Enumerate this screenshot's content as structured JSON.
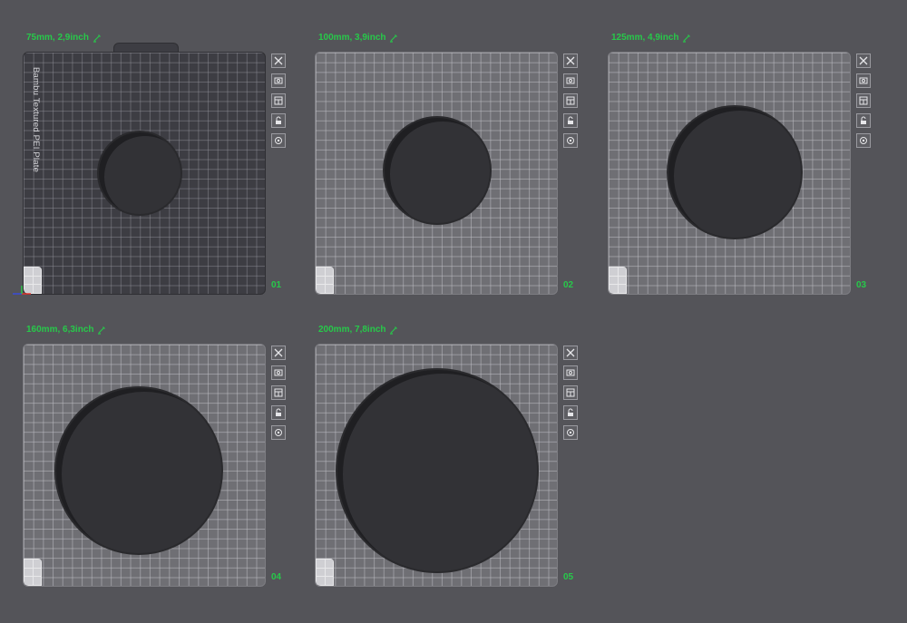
{
  "plates": [
    {
      "id": "plate-01",
      "title": "75mm, 2,9inch",
      "number": "01",
      "textured": true,
      "plate_name": "Bambu Textured PEI Plate"
    },
    {
      "id": "plate-02",
      "title": "100mm, 3,9inch",
      "number": "02",
      "textured": false
    },
    {
      "id": "plate-03",
      "title": "125mm, 4,9inch",
      "number": "03",
      "textured": false
    },
    {
      "id": "plate-04",
      "title": "160mm, 6,3inch",
      "number": "04",
      "textured": false
    },
    {
      "id": "plate-05",
      "title": "200mm, 7,8inch",
      "number": "05",
      "textured": false
    }
  ],
  "colors": {
    "background": "#545459",
    "accent_green": "#27c94a",
    "textured_bed": "#3d3d43",
    "smooth_bed": "#6f6f74",
    "object": "#323236"
  },
  "toolbar_icons": [
    "close-icon",
    "auto-orient-icon",
    "arrange-icon",
    "lock-icon",
    "settings-icon"
  ]
}
